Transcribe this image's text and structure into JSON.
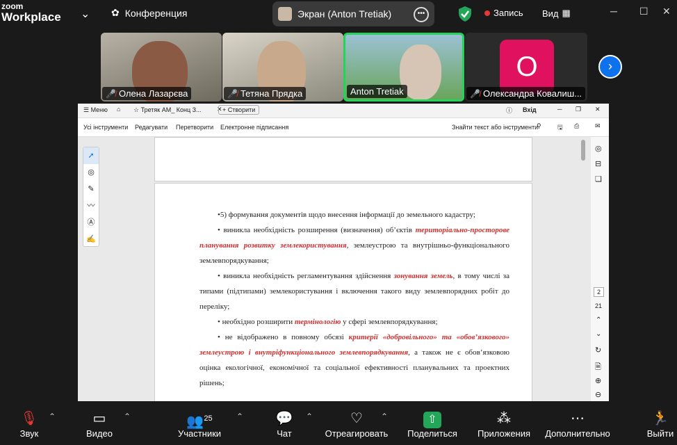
{
  "app": {
    "logo_small": "zoom",
    "logo_big": "Workplace"
  },
  "topbar": {
    "meeting": "Конференция",
    "share_label": "Экран (Anton Tretiak)",
    "record": "Запись",
    "view": "Вид"
  },
  "participants": [
    {
      "name": "Олена Лазарєва",
      "muted": true
    },
    {
      "name": "Тетяна Прядка",
      "muted": true
    },
    {
      "name": "Anton Tretiak",
      "muted": false
    },
    {
      "name": "Олександра Ковалиш...",
      "muted": true,
      "initial": "O"
    }
  ],
  "pdf": {
    "menu": "Меню",
    "tab": "Третяк АМ_ Конц З...",
    "create": "+ Створити",
    "signin": "Вхід",
    "tools": [
      "Усі інструменти",
      "Редагувати",
      "Перетворити",
      "Електронне підписання"
    ],
    "search": "Знайти текст або інструменти",
    "page_num": "2",
    "page_total": "21"
  },
  "doc": {
    "l1": "•5) формування документів щодо внесення інформації до земельного кадастру;",
    "b1a": "виникла необхідність розширення (визначення) об’єктів ",
    "b1r": "територіально-просторове планування розвитку землекористування",
    "b1b": ", землеустрою та внутрішньо-функціонального землевпорядкування;",
    "b2a": "виникла необхідність регламентування здійснення ",
    "b2r": "зонування земель",
    "b2b": ", в тому числі за типами (підтипами) землекористування і включення такого виду землевпорядних робіт до переліку;",
    "b3a": "необхідно розширити ",
    "b3r": "термінологію",
    "b3b": " у сфері землевпорядкування;",
    "b4a": "не відображено в повному обсязі ",
    "b4r": "критерії «добровільного» та «обов’язкового» землеустрою і внутріфункціонального землевпорядкування",
    "b4b": ", а також не є обов’язковою оцінка екологічної, економічної та соціальної ефективності планувальних та проектних рішень;"
  },
  "bottom": {
    "audio": "Звук",
    "video": "Видео",
    "participants": "Участники",
    "participants_count": "25",
    "chat": "Чат",
    "react": "Отреагировать",
    "share": "Поделиться",
    "apps": "Приложения",
    "more": "Дополнительно",
    "leave": "Выйти"
  }
}
